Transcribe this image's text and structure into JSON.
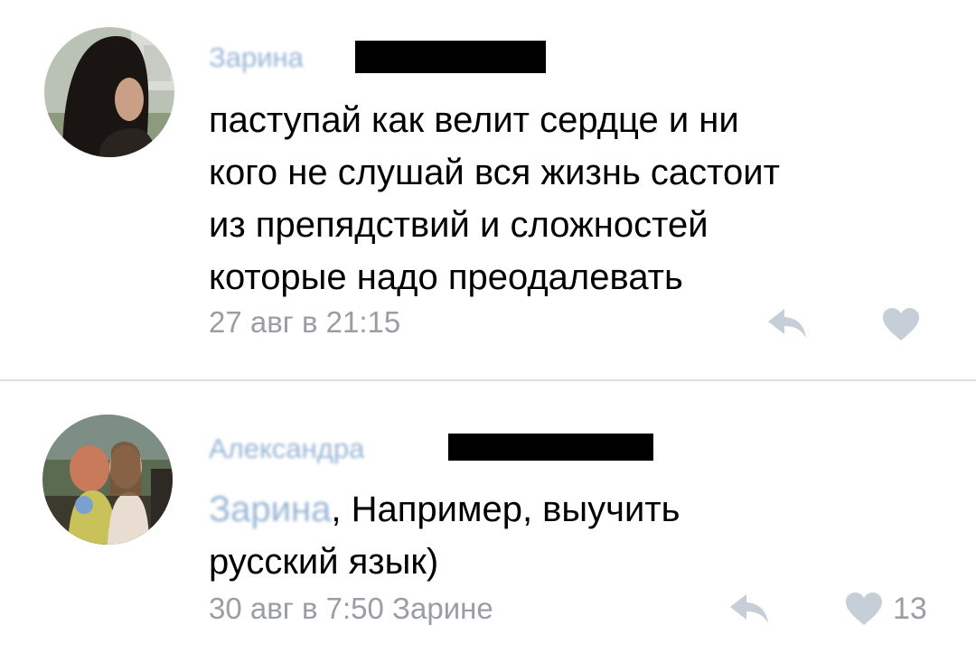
{
  "comments": [
    {
      "author": "Зарина",
      "text_lines": [
        "паступай как велит сердце и ни",
        "кого не слушай вся жизнь састоит",
        "из препядствий и сложностей",
        "которые надо преодалевать"
      ],
      "timestamp": "27 авг в 21:15",
      "likes": ""
    },
    {
      "author": "Александра",
      "mention": "Зарина",
      "text_line1_rest": ", Например, выучить",
      "text_line2": "русский язык)",
      "timestamp": "30 авг в 7:50 Зарине",
      "likes": "13"
    }
  ],
  "icons": {
    "reply": "reply-arrow-icon",
    "like": "heart-icon"
  },
  "colors": {
    "link": "#99b6d4",
    "meta": "#9a9ea4",
    "icon": "#c6ced7",
    "divider": "#dcdfe3"
  }
}
